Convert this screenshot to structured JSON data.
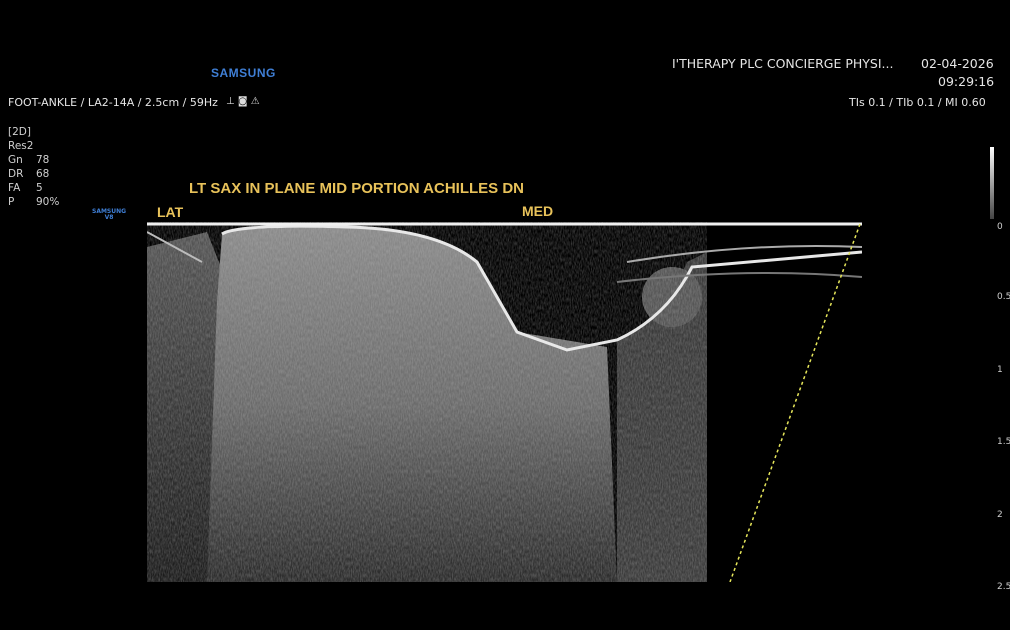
{
  "brand": "SAMSUNG",
  "header": {
    "probe_info": "FOOT-ANKLE / LA2-14A / 2.5cm / 59Hz",
    "facility": "I'THERAPY PLC CONCIERGE PHYSI...",
    "date": "02-04-2026",
    "time": "09:29:16",
    "indices": "TIs  0.1 / TIb  0.1 / MI  0.60"
  },
  "params": [
    {
      "key": "[2D]",
      "value": ""
    },
    {
      "key": "Res2",
      "value": ""
    },
    {
      "key": "Gn",
      "value": "78"
    },
    {
      "key": "DR",
      "value": "68"
    },
    {
      "key": "FA",
      "value": "5"
    },
    {
      "key": "P",
      "value": "90%"
    }
  ],
  "annotations": {
    "title": "LT SAX IN PLANE MID PORTION ACHILLES DN",
    "lat": "LAT",
    "med": "MED"
  },
  "mini_logo": [
    "SAMSUNG",
    "V8"
  ],
  "depth_marks": [
    "0",
    "0.5",
    "1",
    "1.5",
    "2",
    "2.5"
  ],
  "colors": {
    "annotation": "#e8c25a",
    "brand": "#3f7fd6",
    "needle_guide": "#e6e65a"
  },
  "icons": [
    "probe-orientation-icon",
    "camera-icon",
    "power-warning-icon"
  ]
}
